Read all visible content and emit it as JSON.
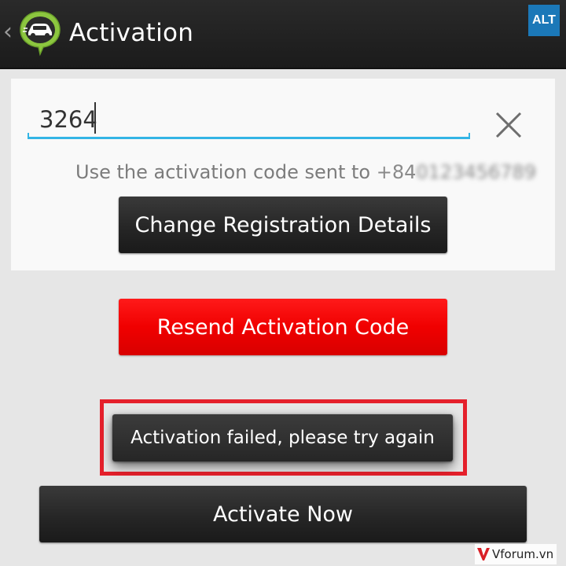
{
  "header": {
    "title": "Activation",
    "alt_badge": "ALT",
    "icons": {
      "back": "back-chevron-icon",
      "app": "car-chat-bubble-icon"
    }
  },
  "form": {
    "code_value": "3264",
    "clear_icon": "close-icon",
    "hint_text": "Use the activation code sent to ",
    "phone_prefix": "+84",
    "phone_number_blurred": "0123456789",
    "change_details_label": "Change Registration Details"
  },
  "actions": {
    "resend_label": "Resend Activation Code",
    "activate_label": "Activate Now"
  },
  "toast": {
    "message": "Activation failed, please try again"
  },
  "watermark": {
    "text": "Vforum.vn"
  },
  "colors": {
    "accent_blue": "#33b5e5",
    "resend_red": "#f00000",
    "highlight_red": "#e5202b",
    "alt_badge_blue": "#1b78b8",
    "actionbar": "#1f1f1f"
  }
}
